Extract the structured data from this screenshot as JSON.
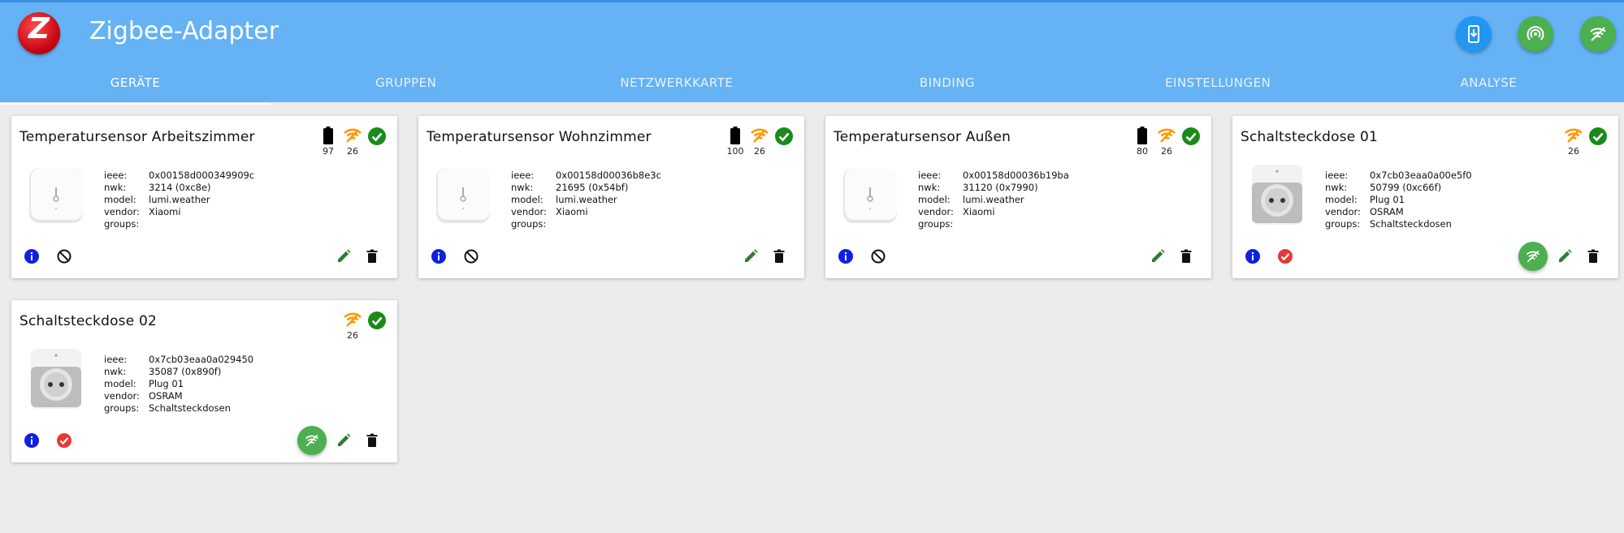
{
  "app": {
    "title": "Zigbee-Adapter",
    "logo_letter": "Z",
    "colors": {
      "header": "#65b2f5",
      "accent_blue": "#2196f3",
      "accent_green": "#4caf50",
      "link_quality": "#ff9800",
      "ok": "#1a8a1a",
      "error": "#e53935"
    }
  },
  "header_actions": [
    {
      "name": "install-update-button",
      "icon": "phone-download-icon"
    },
    {
      "name": "pairing-button",
      "icon": "wireless-pairing-icon"
    },
    {
      "name": "signal-button",
      "icon": "signal-wifi-icon"
    }
  ],
  "tabs": [
    {
      "label": "GERÄTE",
      "active": true
    },
    {
      "label": "GRUPPEN",
      "active": false
    },
    {
      "label": "NETZWERKKARTE",
      "active": false
    },
    {
      "label": "BINDING",
      "active": false
    },
    {
      "label": "EINSTELLUNGEN",
      "active": false
    },
    {
      "label": "ANALYSE",
      "active": false
    }
  ],
  "labels": {
    "ieee": "ieee:",
    "nwk": "nwk:",
    "model": "model:",
    "vendor": "vendor:",
    "groups": "groups:"
  },
  "devices": [
    {
      "title": "Temperatursensor Arbeitszimmer",
      "battery": "97",
      "link": "26",
      "ieee": "0x00158d000349909c",
      "nwk": "3214 (0xc8e)",
      "model": "lumi.weather",
      "vendor": "Xiaomi",
      "groups": "",
      "image": "temperature-sensor",
      "state_icon": "blocked-icon"
    },
    {
      "title": "Temperatursensor Wohnzimmer",
      "battery": "100",
      "link": "26",
      "ieee": "0x00158d00036b8e3c",
      "nwk": "21695 (0x54bf)",
      "model": "lumi.weather",
      "vendor": "Xiaomi",
      "groups": "",
      "image": "temperature-sensor",
      "state_icon": "blocked-icon"
    },
    {
      "title": "Temperatursensor Außen",
      "battery": "80",
      "link": "26",
      "ieee": "0x00158d00036b19ba",
      "nwk": "31120 (0x7990)",
      "model": "lumi.weather",
      "vendor": "Xiaomi",
      "groups": "",
      "image": "temperature-sensor",
      "state_icon": "blocked-icon"
    },
    {
      "title": "Schaltsteckdose 01",
      "link": "26",
      "ieee": "0x7cb03eaa0a00e5f0",
      "nwk": "50799 (0xc66f)",
      "model": "Plug 01",
      "vendor": "OSRAM",
      "groups": "Schaltsteckdosen",
      "image": "smart-plug",
      "state_icon": "red-check-icon"
    },
    {
      "title": "Schaltsteckdose 02",
      "link": "26",
      "ieee": "0x7cb03eaa0a029450",
      "nwk": "35087 (0x890f)",
      "model": "Plug 01",
      "vendor": "OSRAM",
      "groups": "Schaltsteckdosen",
      "image": "smart-plug",
      "state_icon": "red-check-icon"
    }
  ]
}
